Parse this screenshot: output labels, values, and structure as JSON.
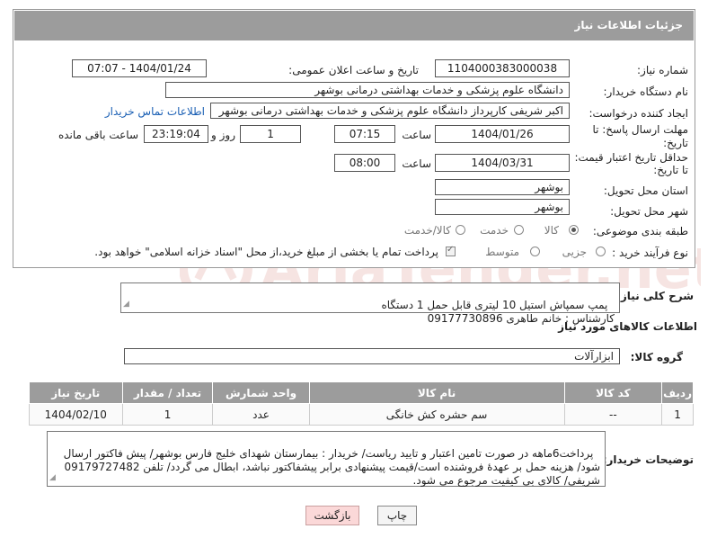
{
  "panel": {
    "title": "جزئیات اطلاعات نیاز"
  },
  "fields": {
    "need_number_label": "شماره نیاز:",
    "need_number": "1104000383000038",
    "announce_label": "تاریخ و ساعت اعلان عمومی:",
    "announce_value": "1404/01/24 - 07:07",
    "buyer_org_label": "نام دستگاه خریدار:",
    "buyer_org": "دانشگاه علوم پزشکی و خدمات بهداشتی درمانی بوشهر",
    "creator_label": "ایجاد کننده درخواست:",
    "creator": "اکبر شریفی کارپرداز دانشگاه علوم پزشکی و خدمات بهداشتی درمانی بوشهر",
    "contact_link": "اطلاعات تماس خریدار",
    "deadline_label_1": "مهلت ارسال پاسخ: تا",
    "deadline_label_2": "تاریخ:",
    "deadline_date": "1404/01/26",
    "time_label": "ساعت",
    "deadline_time": "07:15",
    "days_value": "1",
    "days_label": "روز و",
    "remaining_value": "23:19:04",
    "remaining_label": "ساعت باقی مانده",
    "validity_label_1": "حداقل تاریخ اعتبار قیمت:",
    "validity_label_2": "تا تاریخ:",
    "validity_date": "1404/03/31",
    "validity_time": "08:00",
    "province_label": "استان محل تحویل:",
    "province": "بوشهر",
    "city_label": "شهر محل تحویل:",
    "city": "بوشهر",
    "category_label": "طبقه بندی موضوعی:",
    "category_options": [
      "کالا",
      "خدمت",
      "کالا/خدمت"
    ],
    "category_selected": "کالا",
    "process_label": "نوع فرآیند خرید :",
    "process_options": [
      "جزیی",
      "متوسط"
    ],
    "process_note": "پرداخت تمام یا بخشی از مبلغ خرید،از محل \"اسناد خزانه اسلامی\" خواهد بود."
  },
  "description": {
    "label": "شرح کلی نیاز:",
    "text": "پمپ سمپاش استیل 10 لیتری قابل حمل 1 دستگاه\nکارشناس : خانم طاهری 09177730896"
  },
  "goods": {
    "section_title": "اطلاعات کالاهای مورد نیاز",
    "group_label": "گروه کالا:",
    "group_value": "ابزارآلات",
    "columns": [
      "ردیف",
      "کد کالا",
      "نام کالا",
      "واحد شمارش",
      "تعداد / مقدار",
      "تاریخ نیاز"
    ],
    "rows": [
      [
        "1",
        "--",
        "سم حشره کش خانگی",
        "عدد",
        "1",
        "1404/02/10"
      ]
    ]
  },
  "buyer_notes": {
    "label": "توضیحات خریدار:",
    "text": "پرداخت6ماهه در صورت تامین اعتبار و تایید ریاست/ خریدار : بیمارستان شهدای خلیج فارس بوشهر/ پیش فاکتور ارسال شود/ هزینه حمل بر عهدهٔ فروشنده است/قیمت پیشنهادی برابر پیشفاکتور نباشد، ابطال می گردد/ تلفن 09179727482 شریفی/ کالای بی کیفیت مرجوع می شود."
  },
  "buttons": {
    "print": "چاپ",
    "back": "بازگشت"
  },
  "watermark": {
    "text": "AriaTender.net"
  },
  "colors": {
    "header_bg": "#9c9c9c",
    "link": "#1a5fb4",
    "back_button": "#fbd8d8",
    "watermark": "#c0392b"
  }
}
